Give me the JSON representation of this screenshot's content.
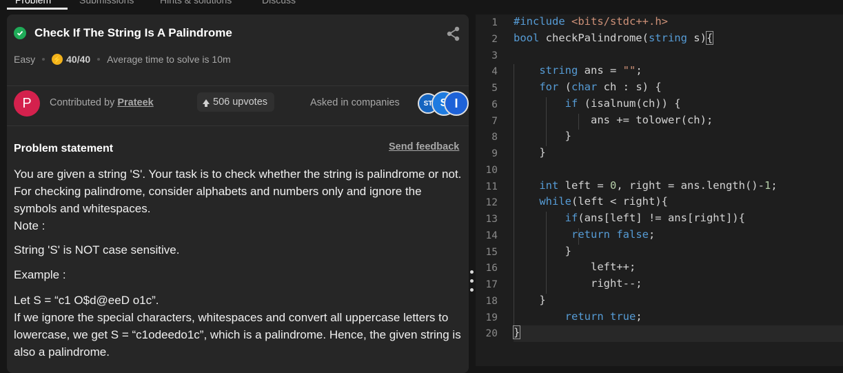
{
  "tabs": [
    "Problem",
    "Submissions",
    "Hints & solutions",
    "Discuss"
  ],
  "problem": {
    "title": "Check If The String Is A Palindrome",
    "difficulty": "Easy",
    "score": "40/40",
    "avg_time": "Average time to solve is 10m",
    "contributed_by_label": "Contributed by",
    "contributor": "Prateek",
    "avatar_letter": "P",
    "upvotes": "506 upvotes",
    "asked_in_label": "Asked in companies",
    "company_logos": [
      "ST",
      "S",
      "I"
    ],
    "statement_heading": "Problem statement",
    "send_feedback": "Send feedback",
    "statement": [
      "You are given a string 'S'. Your task is to check whether the string is palindrome or not. For checking palindrome, consider alphabets and numbers only and ignore the symbols and whitespaces.",
      "Note :",
      "String 'S' is NOT case sensitive.",
      "Example :",
      "Let S = “c1 O$d@eeD o1c”.",
      "If we ignore the special characters, whitespaces and convert all uppercase letters to lowercase, we get S = “c1odeedo1c”, which is a palindrome. Hence, the given string is also a palindrome."
    ]
  },
  "editor": {
    "line_numbers": [
      "1",
      "2",
      "3",
      "4",
      "5",
      "6",
      "7",
      "8",
      "9",
      "10",
      "11",
      "12",
      "13",
      "14",
      "15",
      "16",
      "17",
      "18",
      "19",
      "20"
    ],
    "code_lines": [
      "#include <bits/stdc++.h>",
      "bool checkPalindrome(string s){",
      "",
      "    string ans = \"\";",
      "    for (char ch : s) {",
      "        if (isalnum(ch)) {",
      "            ans += tolower(ch);",
      "        }",
      "    }",
      "",
      "    int left = 0, right = ans.length()-1;",
      "    while(left < right){",
      "        if(ans[left] != ans[right]){",
      "         return false;",
      "        }",
      "            left++;",
      "            right--;",
      "    }",
      "        return true;",
      "}"
    ]
  },
  "colors": {
    "accent_green": "#1fab58",
    "avatar": "#d4214d",
    "coin": "#f2b21b",
    "keyword": "#569cd6",
    "string": "#ce9178",
    "number": "#b5cea8"
  }
}
